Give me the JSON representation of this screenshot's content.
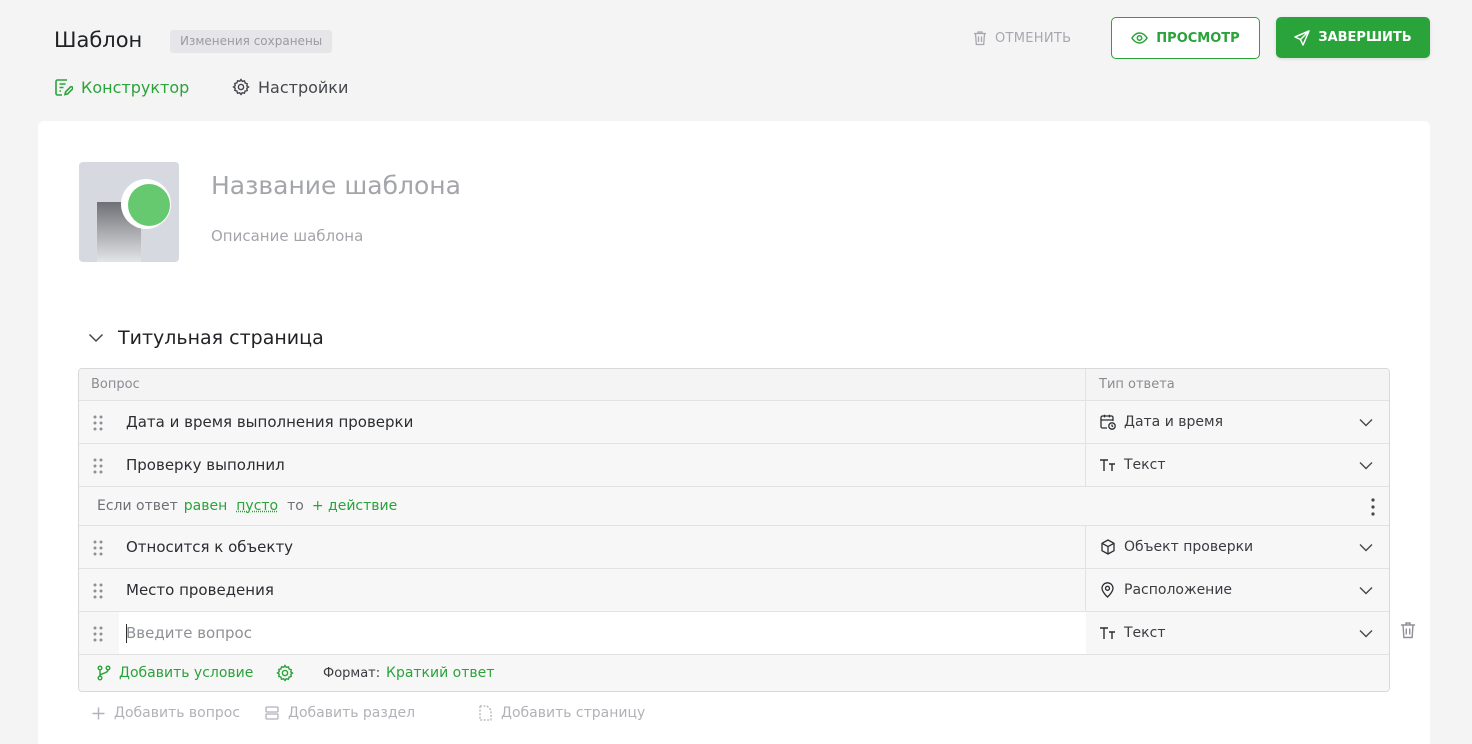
{
  "header": {
    "title": "Шаблон",
    "saved_badge": "Изменения сохранены",
    "cancel_label": "ОТМЕНИТЬ",
    "preview_label": "ПРОСМОТР",
    "finish_label": "ЗАВЕРШИТЬ"
  },
  "tabs": [
    {
      "label": "Конструктор",
      "icon": "builder-icon",
      "active": true
    },
    {
      "label": "Настройки",
      "icon": "gear-icon",
      "active": false
    }
  ],
  "template": {
    "name_placeholder": "Название шаблона",
    "description_placeholder": "Описание шаблона"
  },
  "section": {
    "title": "Титульная страница",
    "columns": {
      "question": "Вопрос",
      "answer_type": "Тип ответа"
    },
    "rows": [
      {
        "question": "Дата и время выполнения проверки",
        "type": "Дата и время",
        "type_icon": "calendar-clock-icon"
      },
      {
        "question": "Проверку выполнил",
        "type": "Текст",
        "type_icon": "text-icon"
      },
      {
        "question": "Относится к объекту",
        "type": "Объект проверки",
        "type_icon": "cube-icon"
      },
      {
        "question": "Место проведения",
        "type": "Расположение",
        "type_icon": "location-pin-icon"
      }
    ],
    "condition": {
      "prefix": "Если ответ",
      "operator": "равен",
      "value": "пусто",
      "then": "то",
      "action": "+ действие"
    },
    "new_question": {
      "placeholder": "Введите вопрос",
      "type": "Текст",
      "type_icon": "text-icon",
      "add_condition": "Добавить условие",
      "format_label": "Формат:",
      "format_value": "Краткий ответ"
    }
  },
  "footer_actions": {
    "add_question": "Добавить вопрос",
    "add_section": "Добавить раздел",
    "add_page": "Добавить страницу"
  },
  "colors": {
    "accent": "#2aa33a",
    "muted": "#a6a8ad"
  }
}
